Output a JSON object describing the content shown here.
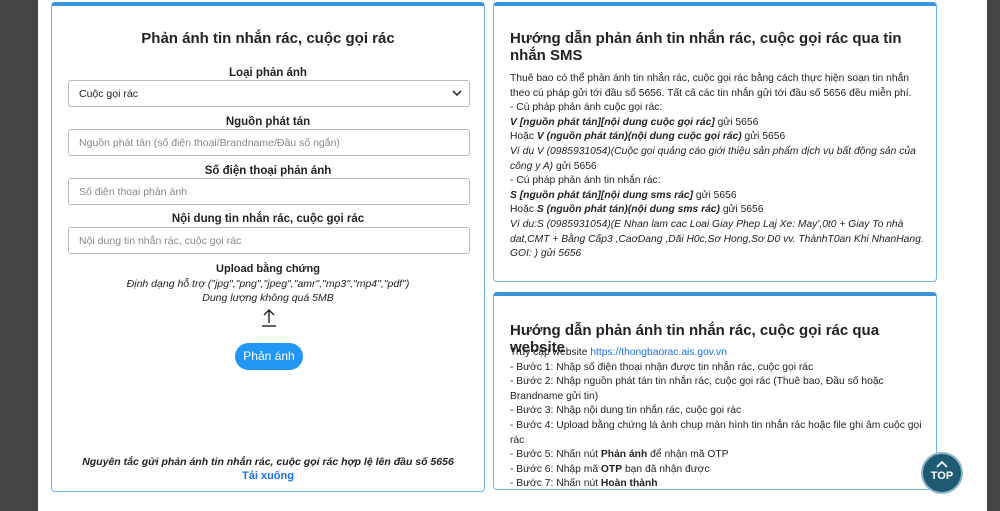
{
  "form": {
    "title": "Phản ánh tin nhắn rác, cuộc gọi rác",
    "type_label": "Loại phản ánh",
    "type_value": "Cuộc gọi rác",
    "source_label": "Nguồn phát tán",
    "source_placeholder": "Nguồn phát tán (số điện thoại/Brandname/Đầu số ngắn)",
    "phone_label": "Số điện thoại phản ánh",
    "phone_placeholder": "Số điện thoại phản ánh",
    "content_label": "Nội dung tin nhắn rác, cuộc gọi rác",
    "content_placeholder": "Nội dung tin nhắn rác, cuộc gọi rác",
    "upload_title": "Upload bằng chứng",
    "upload_formats": "Định dạng hỗ trợ (\"jpg\",\"png\",\"jpeg\",\"amr\",\"mp3\",\"mp4\",\"pdf\")",
    "upload_size": "Dung lượng không quá 5MB",
    "upload_icon": "upload-arrow-icon",
    "submit_label": "Phản ánh",
    "rule_text": "Nguyên tắc gửi phản ánh tin nhắn rác, cuộc gọi rác hợp lệ lên đầu số 5656",
    "download_label": "Tải xuống"
  },
  "sms_guide": {
    "title": "Hướng dẫn phản ánh tin nhắn rác, cuộc gọi rác qua tin nhắn SMS",
    "intro": "Thuê bao có thể phản ánh tin nhắn rác, cuộc gọi rác bằng cách thực hiện soạn tin nhắn theo cú pháp gửi tới đầu số 5656. Tất cả các tin nhắn gửi tới đầu số 5656 đều miễn phí.",
    "call_syntax_heading": "- Cú pháp phản ánh cuộc gọi rác:",
    "call_syntax_1": "V [nguồn phát tán][nội dung cuộc gọi rác]",
    "call_syntax_1_suffix": " gửi 5656",
    "call_or": "Hoặc ",
    "call_syntax_2": "V (nguồn phát tán)(nội dung cuộc gọi rác)",
    "call_syntax_2_suffix": " gửi 5656",
    "call_example": "Ví dụ V (0985931054)(Cuộc gọi quảng cáo giới thiệu sản phẩm dịch vụ bất động sản của công y A)",
    "call_example_suffix": " gửi 5656",
    "sms_syntax_heading": "- Cú pháp phản ánh tin nhắn rác:",
    "sms_syntax_1": "S [nguồn phát tán][nội dung sms rác]",
    "sms_syntax_1_suffix": " gửi 5656",
    "sms_or": "Hoặc ",
    "sms_syntax_2": "S (nguồn phát tán)(nội dung sms rác)",
    "sms_syntax_2_suffix": " gửi 5656",
    "sms_example": "Ví du:S (0985931054)(E Nhan lam cac Loai Giay Phep Laj Xe: May',0t0 + Giay To nhà dat,CMT + Bằng Cấp3 ,CaơDang ,Dăi H0c,Sơ Hong,Sơ D0 vv. ThànhT0an Khi NhanHang. GOI: ) gửi 5656"
  },
  "web_guide": {
    "title": "Hướng dẫn phản ánh tin nhắn rác, cuộc gọi rác qua website",
    "access_prefix": "Truy cập website ",
    "access_url": "https://thongbaorac.ais.gov.vn",
    "step1": "- Bước 1: Nhập số điện thoại nhận được tin nhắn rác, cuộc gọi rác",
    "step2": "- Bước 2: Nhập nguồn phát tán tin nhắn rác, cuộc gọi rác (Thuê bao, Đầu số hoặc Brandname gửi tin)",
    "step3": "- Bước 3: Nhập nội dung tin nhắn rác, cuộc gọi rác",
    "step4": "- Bước 4: Upload bằng chứng là ảnh chụp màn hình tin nhắn rác hoặc file ghi âm cuộc gọi rác",
    "step5_prefix": "- Bước 5: Nhấn nút ",
    "step5_bold": "Phản ánh",
    "step5_suffix": " để nhận mã OTP",
    "step6_prefix": "- Bước 6: Nhập mã ",
    "step6_bold": "OTP",
    "step6_suffix": " bạn đã nhận được",
    "step7_prefix": "- Bước 7: Nhấn nút ",
    "step7_bold": "Hoàn thành"
  },
  "top_button": {
    "label": "TOP",
    "icon": "chevron-up-icon"
  }
}
